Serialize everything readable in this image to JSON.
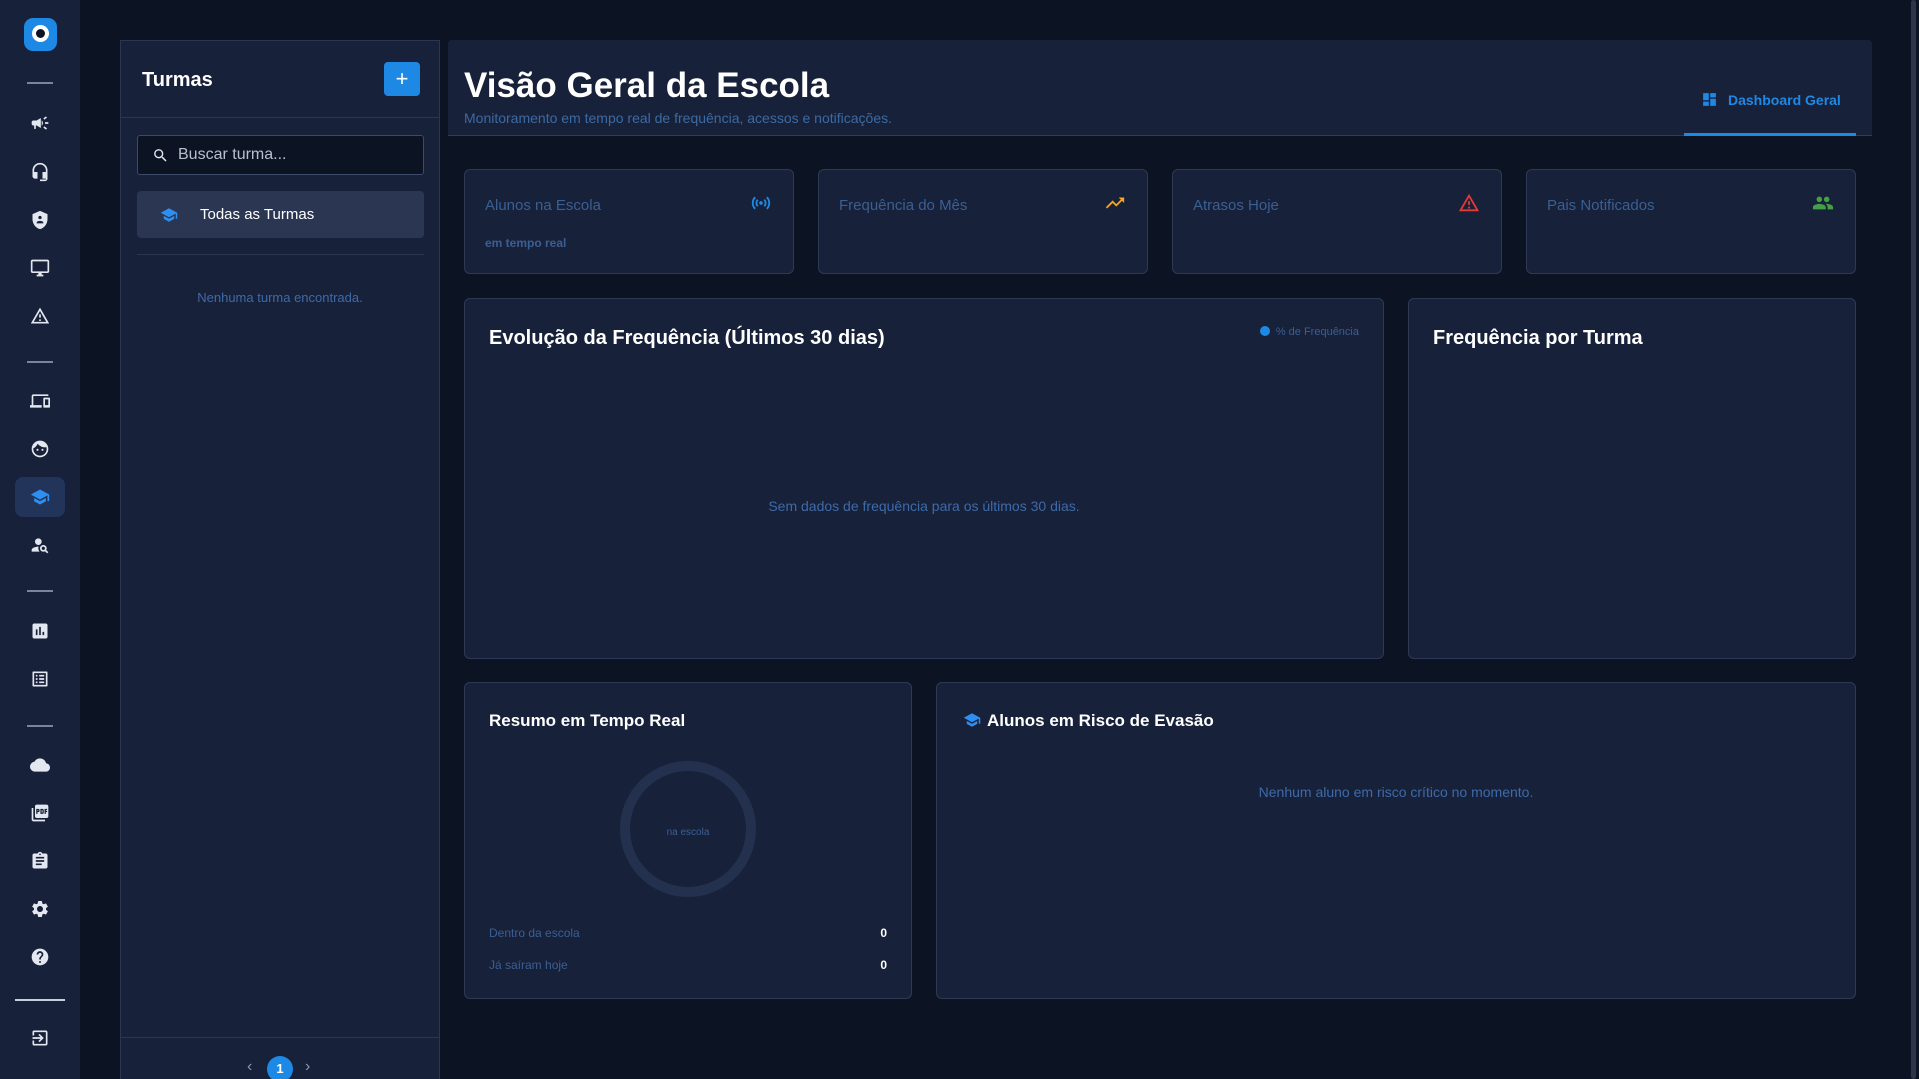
{
  "rail": {
    "items": [
      {
        "icon": "megaphone-icon"
      },
      {
        "icon": "headset-icon"
      },
      {
        "icon": "shield-icon"
      },
      {
        "icon": "monitor-icon"
      },
      {
        "icon": "warning-icon"
      },
      {
        "icon": "devices-icon"
      },
      {
        "icon": "face-icon"
      },
      {
        "icon": "school-icon",
        "active": true
      },
      {
        "icon": "person-search-icon"
      },
      {
        "icon": "bar-chart-icon"
      },
      {
        "icon": "list-alt-icon"
      },
      {
        "icon": "cloud-icon"
      },
      {
        "icon": "pdf-icon"
      },
      {
        "icon": "clipboard-icon"
      },
      {
        "icon": "gear-icon"
      },
      {
        "icon": "help-icon"
      },
      {
        "icon": "logout-icon"
      }
    ]
  },
  "classes_panel": {
    "title": "Turmas",
    "add_label": "+",
    "search_placeholder": "Buscar turma...",
    "items": [
      {
        "label": "Todas as Turmas"
      }
    ],
    "empty_text": "Nenhuma turma encontrada.",
    "pagination": {
      "prev": "‹",
      "current": "1",
      "next": "›"
    }
  },
  "header": {
    "title": "Visão Geral da Escola",
    "subtitle": "Monitoramento em tempo real de frequência, acessos e notificações.",
    "tab_label": "Dashboard Geral"
  },
  "stats": [
    {
      "label": "Alunos na Escola",
      "sub": "em tempo real",
      "icon": "broadcast-icon",
      "color": "#1e88e5"
    },
    {
      "label": "Frequência do Mês",
      "sub": "",
      "icon": "trending-up-icon",
      "color": "#f5a524"
    },
    {
      "label": "Atrasos Hoje",
      "sub": "",
      "icon": "warning-icon",
      "color": "#e53935"
    },
    {
      "label": "Pais Notificados",
      "sub": "",
      "icon": "groups-icon",
      "color": "#43a047"
    }
  ],
  "attendance_chart": {
    "title": "Evolução da Frequência (Últimos 30 dias)",
    "legend": "% de Frequência",
    "empty_text": "Sem dados de frequência para os últimos 30 dias."
  },
  "class_chart": {
    "title": "Frequência por Turma"
  },
  "realtime": {
    "title": "Resumo em Tempo Real",
    "donut_label": "na escola",
    "rows": [
      {
        "label": "Dentro da escola",
        "value": "0"
      },
      {
        "label": "Já saíram hoje",
        "value": "0"
      }
    ]
  },
  "risk": {
    "title": "Alunos em Risco de Evasão",
    "empty_text": "Nenhum aluno em risco crítico no momento."
  },
  "colors": {
    "accent": "#1e88e5",
    "background": "#0c1424",
    "surface": "#18213a"
  }
}
